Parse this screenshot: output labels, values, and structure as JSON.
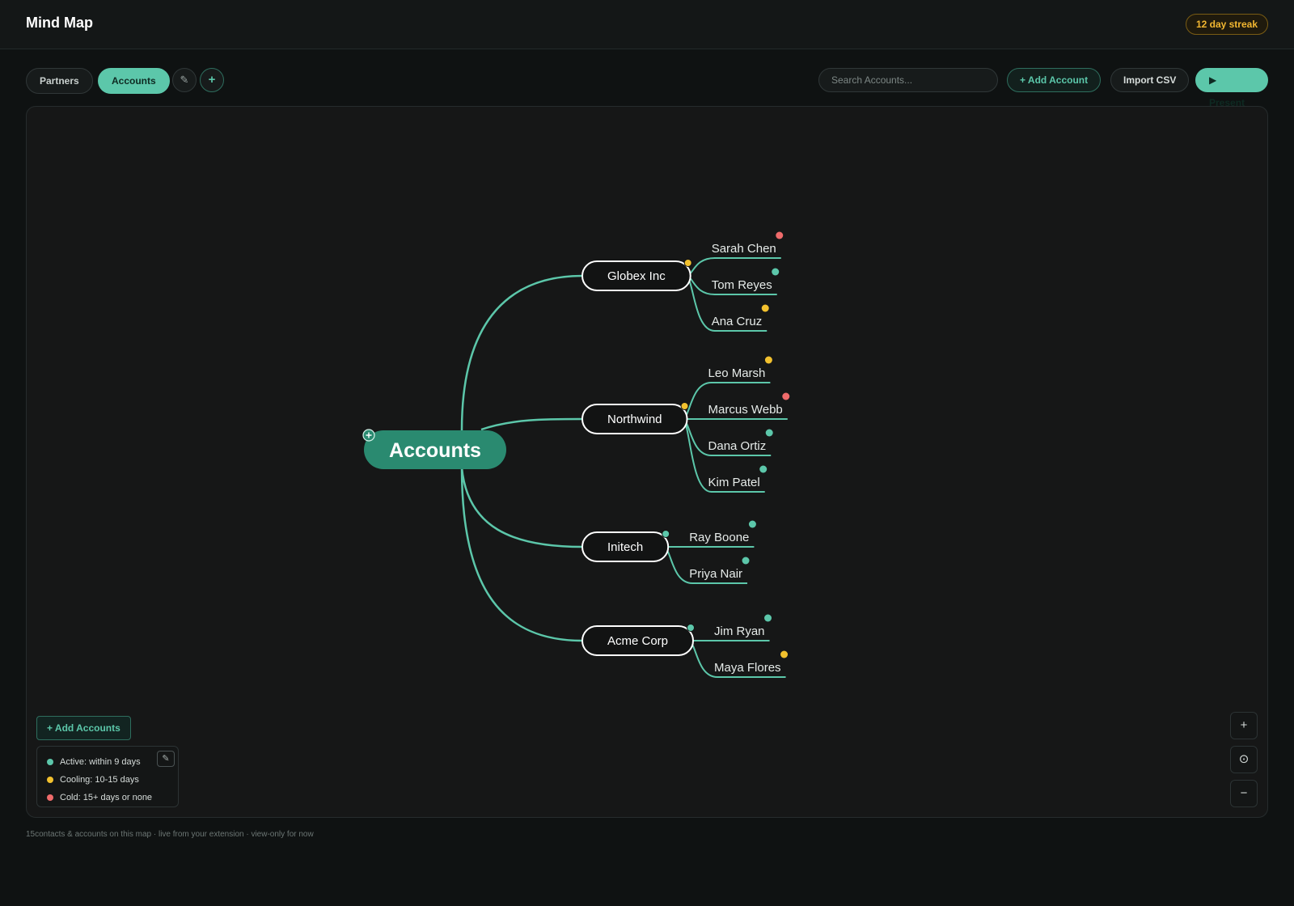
{
  "app": {
    "title": "Mind Map",
    "streak": "12 day streak"
  },
  "toolbar": {
    "tabs": [
      {
        "label": "Partners"
      },
      {
        "label": "Accounts",
        "active": true
      }
    ],
    "edit_icon": "pencil-icon",
    "add_icon": "plus-icon",
    "search_placeholder": "Search Accounts...",
    "add_account_label": "+ Add Account",
    "import_label": "Import CSV",
    "present_label": "▶ Present"
  },
  "mindmap": {
    "root": "Accounts",
    "accounts": [
      {
        "name": "Globex Inc",
        "status": "cooling",
        "contacts": [
          {
            "name": "Sarah Chen",
            "status": "cold"
          },
          {
            "name": "Tom Reyes",
            "status": "active"
          },
          {
            "name": "Ana Cruz",
            "status": "cooling"
          }
        ]
      },
      {
        "name": "Northwind",
        "status": "cooling",
        "contacts": [
          {
            "name": "Leo Marsh",
            "status": "cooling"
          },
          {
            "name": "Marcus Webb",
            "status": "cold"
          },
          {
            "name": "Dana Ortiz",
            "status": "active"
          },
          {
            "name": "Kim Patel",
            "status": "active"
          }
        ]
      },
      {
        "name": "Initech",
        "status": "active",
        "contacts": [
          {
            "name": "Ray Boone",
            "status": "active"
          },
          {
            "name": "Priya Nair",
            "status": "active"
          }
        ]
      },
      {
        "name": "Acme Corp",
        "status": "active",
        "contacts": [
          {
            "name": "Jim Ryan",
            "status": "active"
          },
          {
            "name": "Maya Flores",
            "status": "cooling"
          }
        ]
      }
    ]
  },
  "status_colors": {
    "active": "#5cc7aa",
    "cooling": "#f2c12e",
    "cold": "#ef6b6b"
  },
  "colors": {
    "accent": "#5cc7aa",
    "root_fill": "#2a8a70",
    "branch_stroke": "#5cc7aa"
  },
  "legend": {
    "add_accounts_label": "+ Add Accounts",
    "items": [
      {
        "label": "Active: within 9 days",
        "status": "active"
      },
      {
        "label": "Cooling: 10-15 days",
        "status": "cooling"
      },
      {
        "label": "Cold: 15+ days or none",
        "status": "cold"
      }
    ]
  },
  "zoom": {
    "in": "+",
    "reset": "⊙",
    "out": "−"
  },
  "footer": "15contacts & accounts on this map · live from your extension · view-only for now"
}
